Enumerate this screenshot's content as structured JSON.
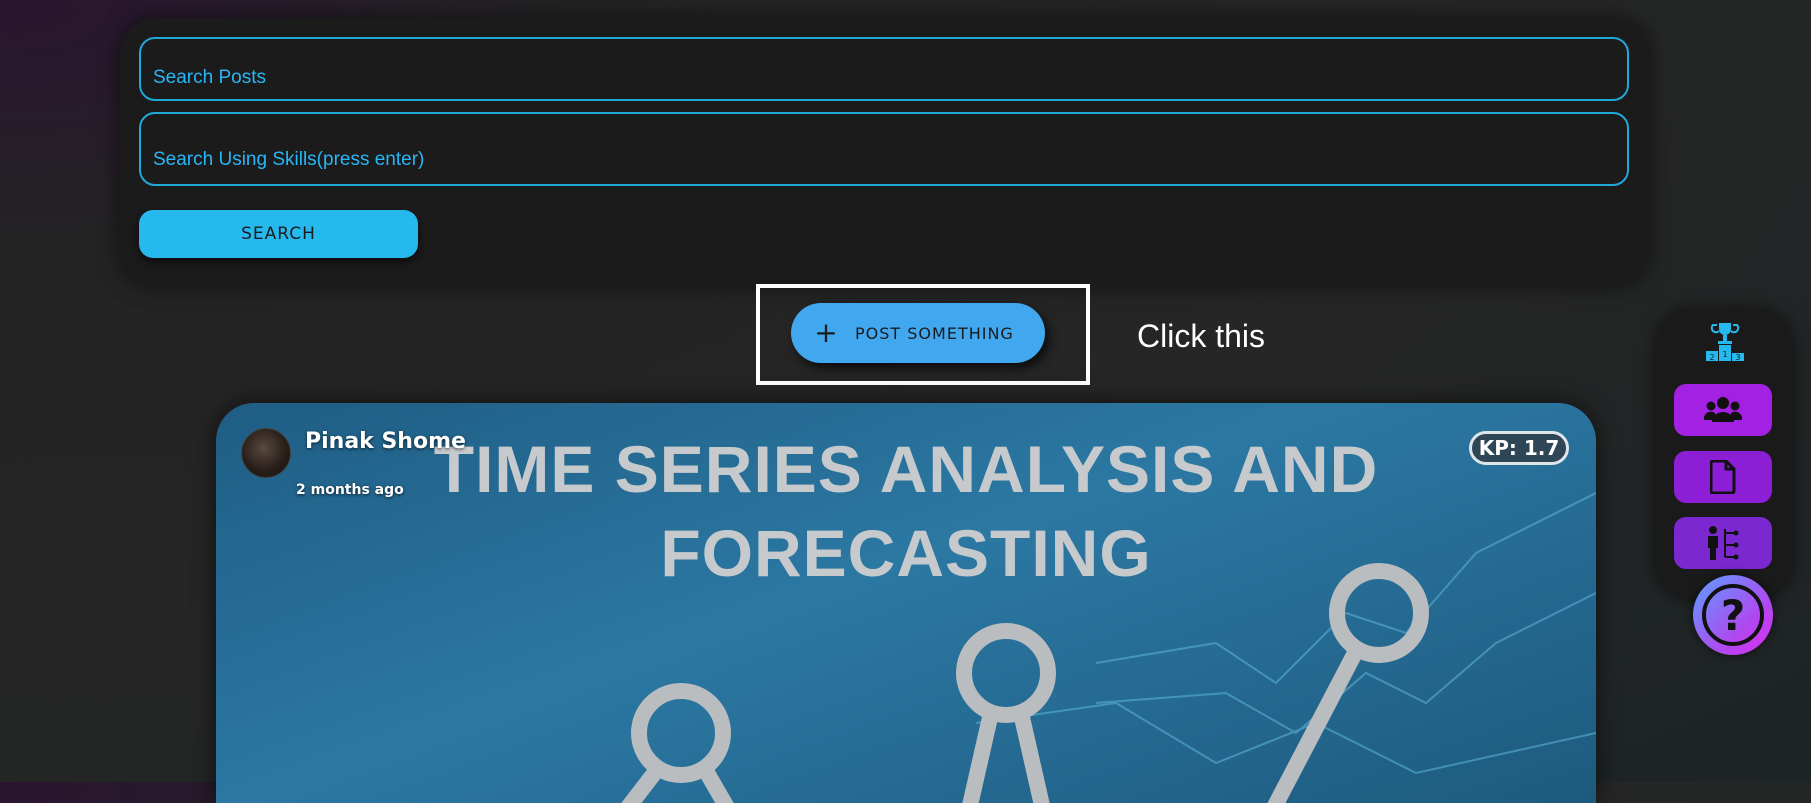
{
  "search": {
    "posts_placeholder": "Search Posts",
    "skills_placeholder": "Search Using Skills(press enter)",
    "button_label": "SEARCH"
  },
  "post_button": {
    "label": "POST SOMETHING",
    "icon": "plus-icon"
  },
  "hint": "Click this",
  "post": {
    "author": "Pinak Shome",
    "time_ago": "2 months ago",
    "kp": "KP: 1.7",
    "image_title_line1": "TIME SERIES ANALYSIS AND",
    "image_title_line2": "FORECASTING"
  },
  "dock": {
    "icons": [
      "leaderboard-trophy-icon",
      "community-icon",
      "document-icon",
      "hierarchy-icon",
      "help-icon"
    ],
    "trophy_ranks": [
      "2",
      "1",
      "3"
    ],
    "help_glyph": "?"
  },
  "colors": {
    "accent_cyan": "#25b9ee",
    "post_button": "#41a8f0",
    "dock_purple": "#a221e3",
    "panel_bg": "#1b1b1b"
  }
}
